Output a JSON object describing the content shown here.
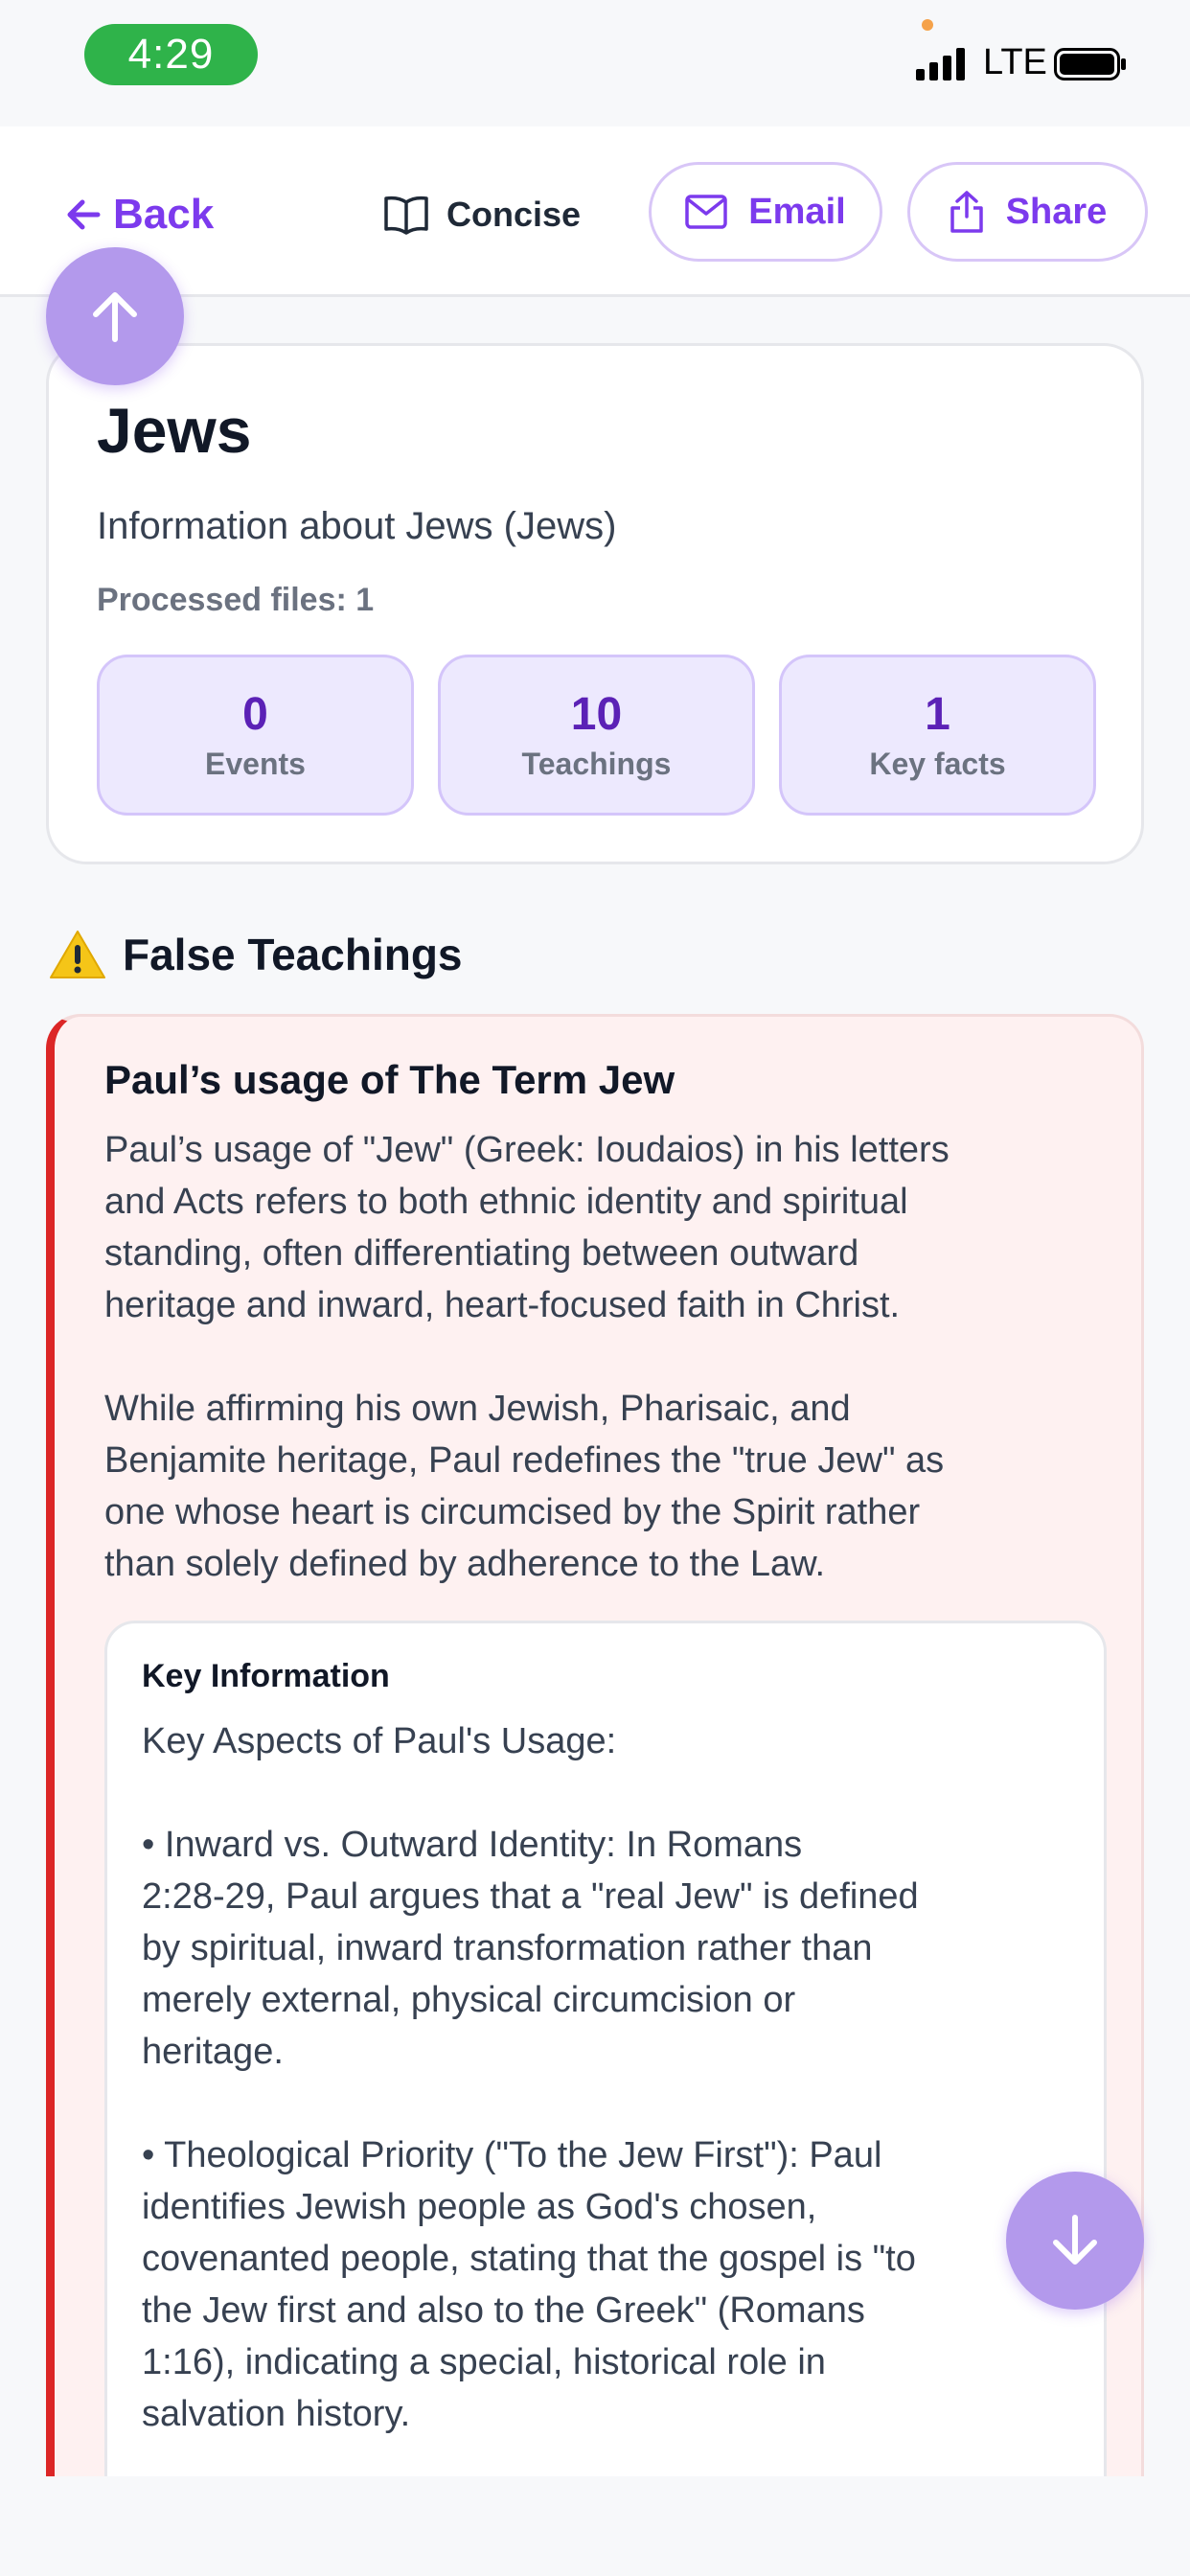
{
  "status_bar": {
    "time": "4:29",
    "network": "LTE",
    "icons": [
      "signal-icon",
      "battery-icon"
    ]
  },
  "header": {
    "back_label": "Back",
    "concise_label": "Concise",
    "email_label": "Email",
    "share_label": "Share",
    "icons": [
      "arrow-left-icon",
      "book-icon",
      "mail-icon",
      "share-icon"
    ]
  },
  "summary": {
    "title": "Jews",
    "subtitle": "Information about Jews (Jews)",
    "processed": "Processed files: 1",
    "stats": [
      {
        "value": "0",
        "label": "Events"
      },
      {
        "value": "10",
        "label": "Teachings"
      },
      {
        "value": "1",
        "label": "Key facts"
      }
    ]
  },
  "section": {
    "heading": "False Teachings",
    "icon": "warning-icon"
  },
  "teaching": {
    "title": "Paul’s usage of The Term Jew",
    "body": "Paul’s usage of \"Jew\" (Greek: Ioudaios) in his letters\nand Acts refers to both ethnic identity and spiritual\nstanding, often differentiating between outward\nheritage and inward, heart-focused faith in Christ.\n\nWhile affirming his own Jewish, Pharisaic, and\nBenjamite heritage, Paul redefines the \"true Jew\" as\none whose heart is circumcised by the Spirit rather\nthan solely defined by adherence to the Law.",
    "key_heading": "Key Information",
    "key_body": "Key Aspects of Paul's Usage:\n\n• Inward vs. Outward Identity: In Romans\n2:28-29, Paul argues that a \"real Jew\" is defined\nby spiritual, inward transformation rather than\nmerely external, physical circumcision or\nheritage.\n\n• Theological Priority (\"To the Jew First\"): Paul\nidentifies Jewish people as God's chosen,\ncovenanted people, stating that the gospel is \"to\nthe Jew first and also to the Greek\" (Romans\n1:16), indicating a special, historical role in\nsalvation history."
  },
  "colors": {
    "accent": "#7c3aed",
    "status_pill": "#2fb34a",
    "danger": "#dc2626",
    "card_tint": "#fef1f1",
    "stat_bg": "#ede9fe"
  }
}
